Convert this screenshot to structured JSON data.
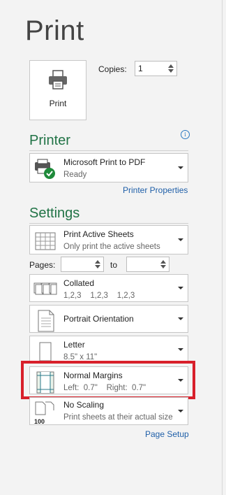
{
  "title": "Print",
  "print_button": {
    "label": "Print"
  },
  "copies": {
    "label": "Copies:",
    "value": "1"
  },
  "printer": {
    "heading": "Printer",
    "info_icon": "i",
    "name": "Microsoft Print to PDF",
    "status": "Ready",
    "properties_link": "Printer Properties"
  },
  "settings": {
    "heading": "Settings",
    "what_to_print": {
      "main": "Print Active Sheets",
      "sub": "Only print the active sheets"
    },
    "pages": {
      "label": "Pages:",
      "from": "",
      "to_label": "to",
      "to": ""
    },
    "collation": {
      "main": "Collated",
      "sub": "1,2,3    1,2,3    1,2,3"
    },
    "orientation": {
      "main": "Portrait Orientation"
    },
    "paper": {
      "main": "Letter",
      "sub": "8.5\" x 11\""
    },
    "margins": {
      "main": "Normal Margins",
      "sub": "Left:  0.7\"    Right:  0.7\""
    },
    "scaling": {
      "main": "No Scaling",
      "sub": "Print sheets at their actual size",
      "icon_text": "100"
    },
    "page_setup_link": "Page Setup"
  },
  "colors": {
    "accent": "#217346",
    "link": "#1f5fa8",
    "highlight": "#d8202b"
  }
}
